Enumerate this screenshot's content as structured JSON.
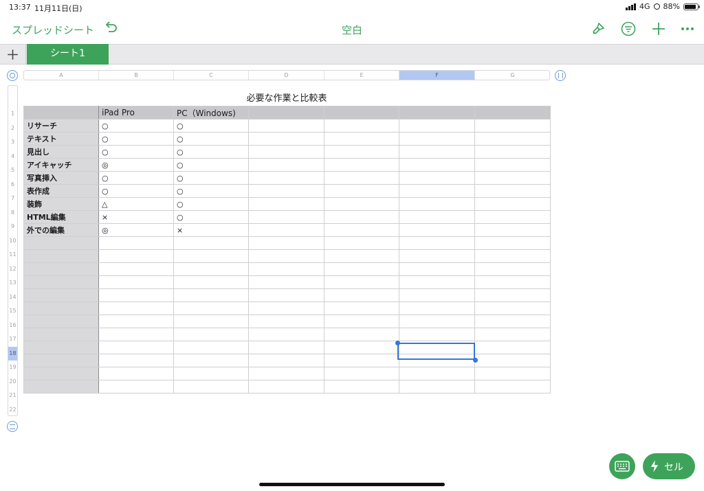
{
  "status_bar": {
    "time": "13:37",
    "date": "11月11日(日)",
    "network": "4G",
    "battery": "88%",
    "battery_level": 0.88
  },
  "toolbar": {
    "back_label": "スプレッドシート",
    "title": "空白",
    "icons": [
      "undo-icon",
      "paintbrush-icon",
      "filter-icon",
      "plus-icon",
      "more-icon"
    ]
  },
  "sheet_tabs": {
    "add_label": "+",
    "tabs": [
      "シート1"
    ]
  },
  "column_headers": [
    "A",
    "B",
    "C",
    "D",
    "E",
    "F",
    "G"
  ],
  "selected_column": "F",
  "row_headers": [
    "1",
    "2",
    "3",
    "4",
    "5",
    "6",
    "7",
    "8",
    "9",
    "10",
    "11",
    "12",
    "13",
    "14",
    "15",
    "16",
    "17",
    "18",
    "19",
    "20",
    "21",
    "22"
  ],
  "selected_row": "18",
  "table": {
    "title": "必要な作業と比較表",
    "header": [
      "",
      "iPad Pro",
      "PC（Windows)",
      "",
      "",
      "",
      ""
    ],
    "rows": [
      [
        "リサーチ",
        "○",
        "○"
      ],
      [
        "テキスト",
        "○",
        "○"
      ],
      [
        "見出し",
        "○",
        "○"
      ],
      [
        "アイキャッチ",
        "◎",
        "○"
      ],
      [
        "写真挿入",
        "○",
        "○"
      ],
      [
        "表作成",
        "○",
        "○"
      ],
      [
        "装飾",
        "△",
        "○"
      ],
      [
        "HTML編集",
        "×",
        "○"
      ],
      [
        "外での編集",
        "◎",
        "×"
      ],
      [
        "",
        "",
        ""
      ],
      [
        "",
        "",
        ""
      ],
      [
        "",
        "",
        ""
      ],
      [
        "",
        "",
        ""
      ],
      [
        "",
        "",
        ""
      ],
      [
        "",
        "",
        ""
      ],
      [
        "",
        "",
        ""
      ],
      [
        "",
        "",
        ""
      ],
      [
        "",
        "",
        ""
      ],
      [
        "",
        "",
        ""
      ],
      [
        "",
        "",
        ""
      ],
      [
        "",
        "",
        ""
      ]
    ]
  },
  "bottom": {
    "cell_button_label": "セル",
    "cell_button_icon": "bolt-icon",
    "keyboard_icon": "keyboard-icon"
  },
  "colors": {
    "accent": "#3ea35a",
    "selection": "#3477d6",
    "header_select": "#b3c7f3"
  }
}
